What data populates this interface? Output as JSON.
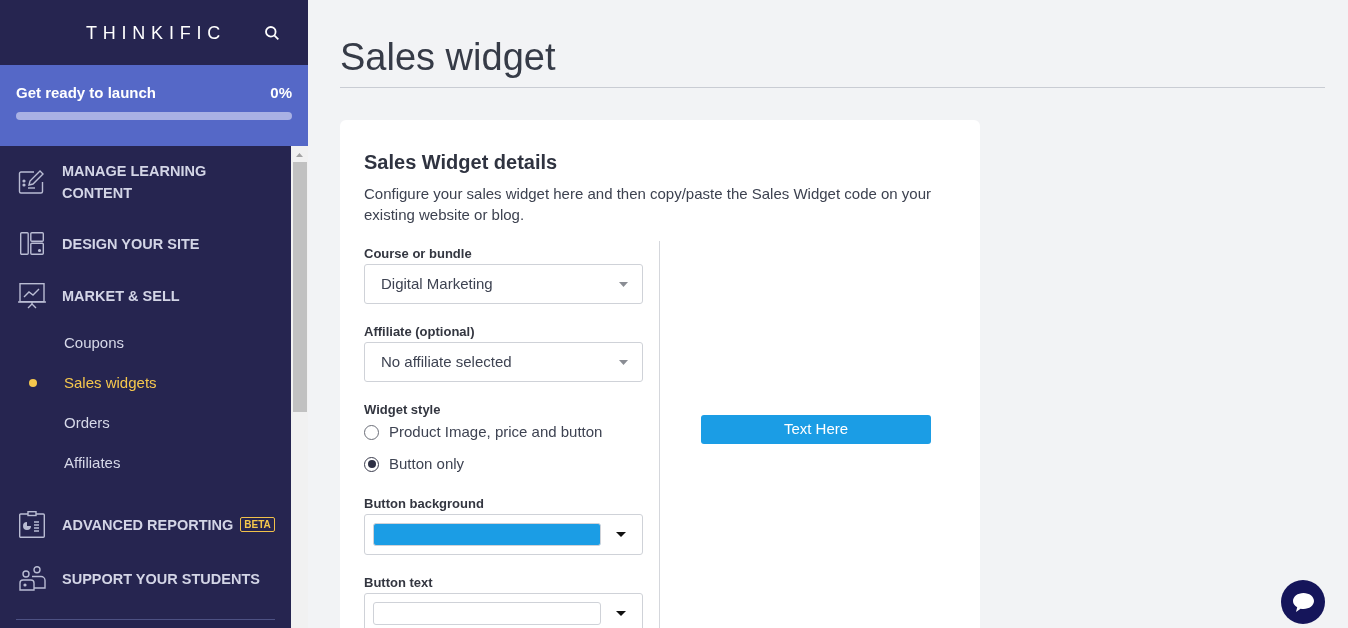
{
  "sidebar": {
    "logo": "THINKIFIC",
    "launch": {
      "label": "Get ready to launch",
      "percent": "0%",
      "level": 0
    },
    "sections": [
      {
        "label": "MANAGE LEARNING CONTENT"
      },
      {
        "label": "DESIGN YOUR SITE"
      },
      {
        "label": "MARKET & SELL",
        "children": [
          {
            "label": "Coupons",
            "selected": false
          },
          {
            "label": "Sales widgets",
            "selected": true
          },
          {
            "label": "Orders",
            "selected": false
          },
          {
            "label": "Affiliates",
            "selected": false
          }
        ]
      },
      {
        "label": "ADVANCED REPORTING",
        "badge": "BETA"
      },
      {
        "label": "SUPPORT YOUR STUDENTS"
      }
    ]
  },
  "page": {
    "title": "Sales widget"
  },
  "card": {
    "title": "Sales Widget details",
    "description": "Configure your sales widget here and then copy/paste the Sales Widget code on your existing website or blog.",
    "fields": [
      {
        "kind": "select",
        "label": "Course or bundle",
        "value": "Digital Marketing"
      },
      {
        "kind": "select",
        "label": "Affiliate (optional)",
        "value": "No affiliate selected"
      },
      {
        "kind": "radio",
        "label": "Widget style",
        "options": [
          {
            "label": "Product Image, price and button",
            "selected": false
          },
          {
            "label": "Button only",
            "selected": true
          }
        ]
      },
      {
        "kind": "color",
        "label": "Button background",
        "color": "#1b9de5"
      },
      {
        "kind": "color",
        "label": "Button text",
        "color": "#ffffff"
      }
    ],
    "preview": {
      "button": "Text Here"
    }
  }
}
